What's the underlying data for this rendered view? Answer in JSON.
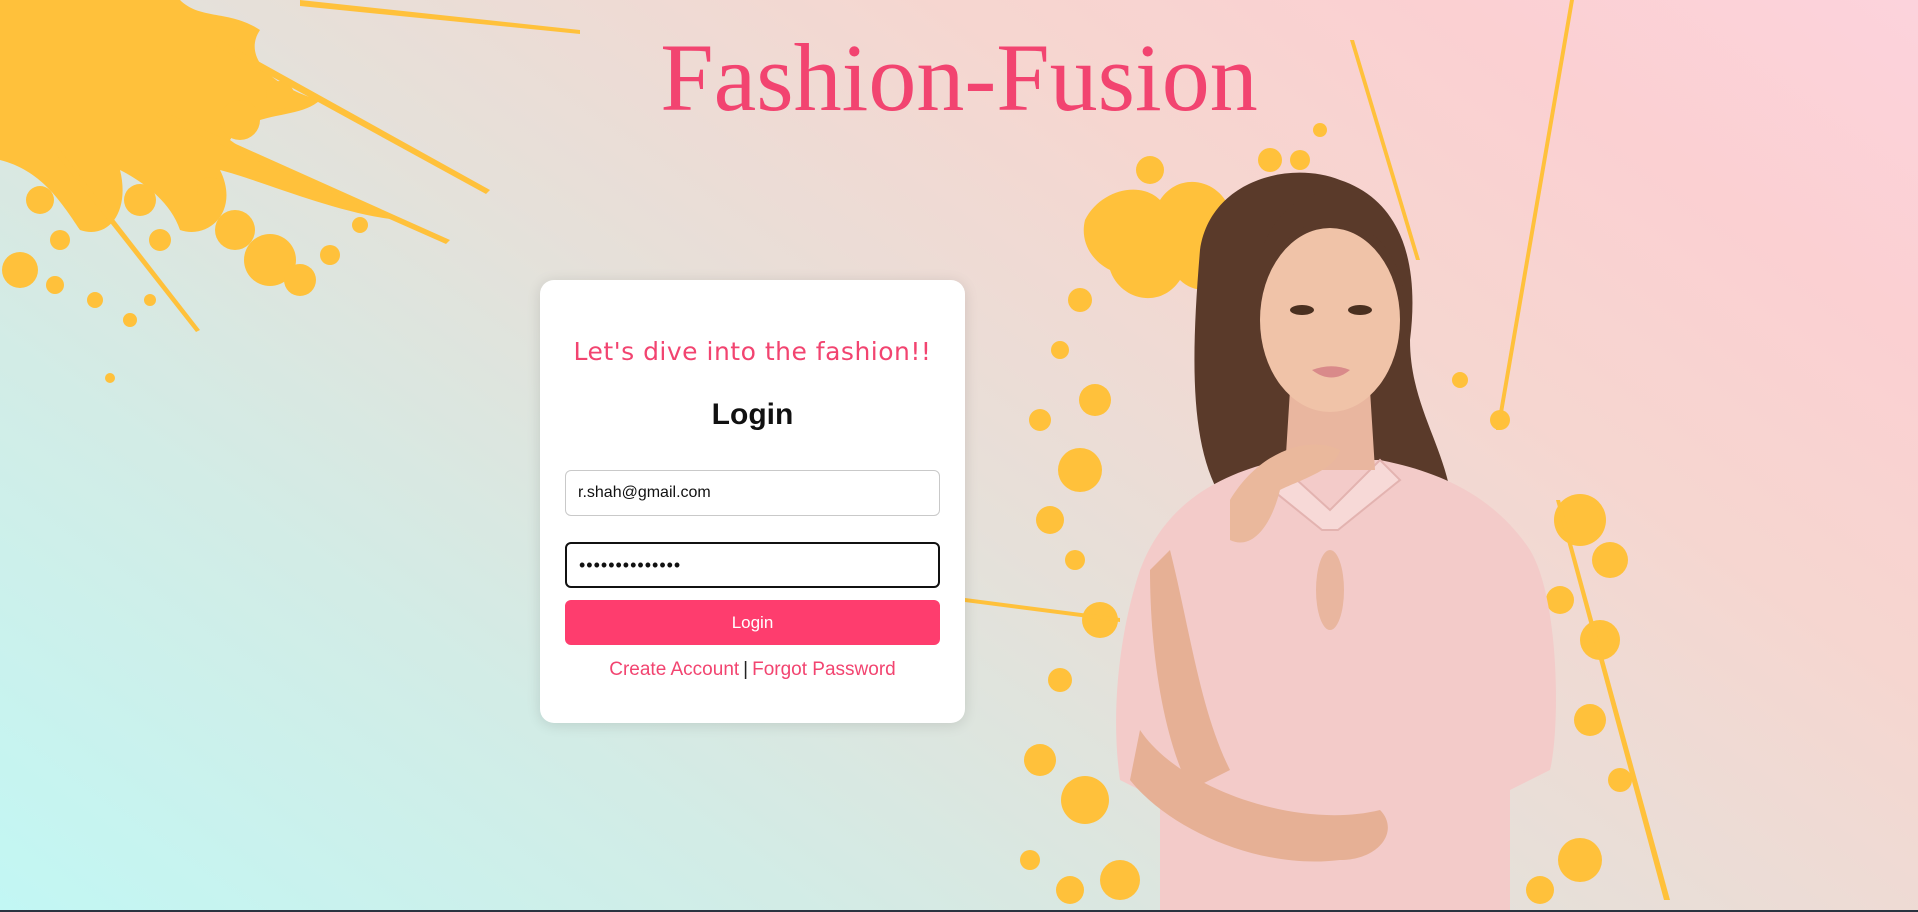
{
  "brand": {
    "title": "Fashion-Fusion"
  },
  "login_card": {
    "tagline": "Let's dive into the fashion!!",
    "heading": "Login",
    "email_value": "r.shah@gmail.com",
    "password_value": "••••••••••••••",
    "submit_label": "Login",
    "create_account_label": "Create Account",
    "separator": "|",
    "forgot_password_label": "Forgot Password"
  },
  "colors": {
    "brand_pink": "#f24470",
    "button_pink": "#fe3d6e",
    "splash_yellow": "#ffc13b"
  },
  "decorations": {
    "splash": "paint-splash-yellow",
    "hero": "model-in-pink-dress"
  }
}
